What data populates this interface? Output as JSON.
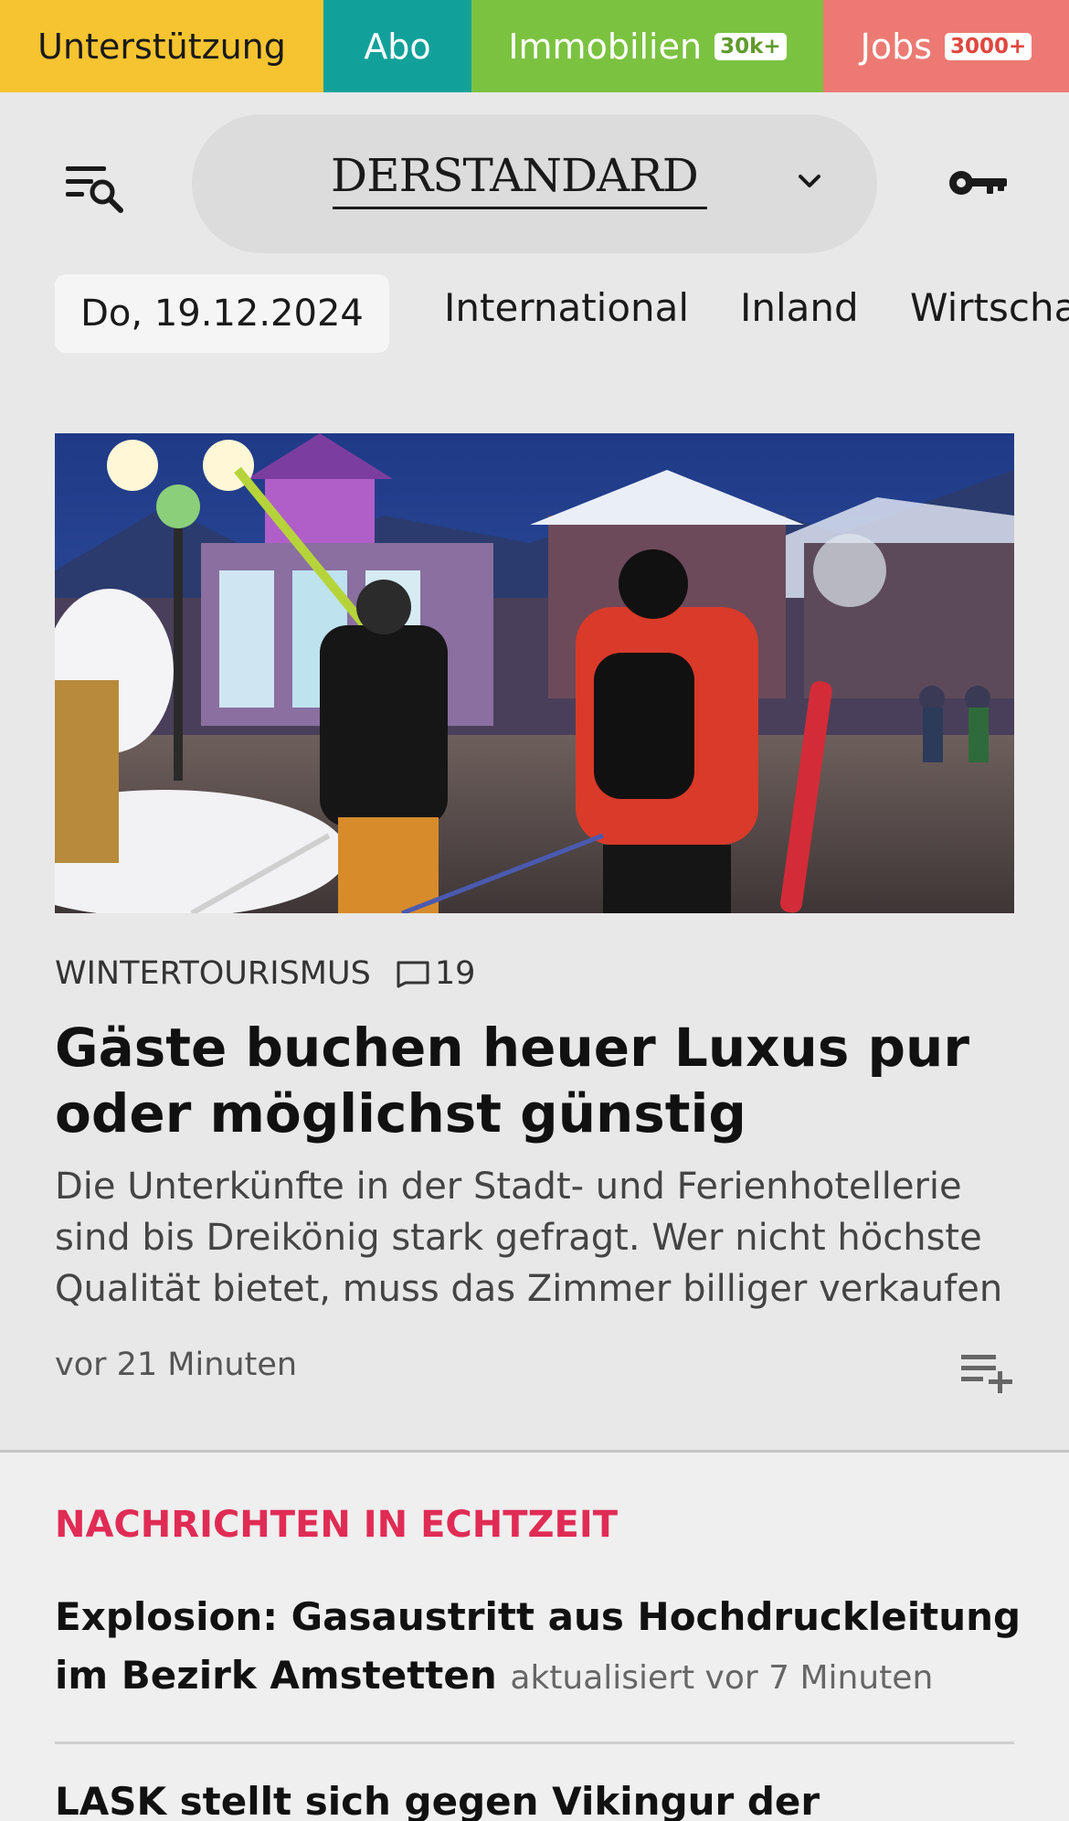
{
  "topnav": {
    "support": "Unterstützung",
    "abo": "Abo",
    "immobilien": "Immobilien",
    "immobilien_badge": "30k+",
    "jobs": "Jobs",
    "jobs_badge": "3000+"
  },
  "header": {
    "logo": "DERSTANDARD"
  },
  "sections": {
    "date": "Do, 19.12.2024",
    "tabs": [
      "International",
      "Inland",
      "Wirtschaft"
    ]
  },
  "hero": {
    "image_alt": "Skifahrer in einem beleuchteten Wintersportort am Abend",
    "kicker": "WINTERTOURISMUS",
    "comments": "19",
    "headline": "Gäste buchen heuer Luxus pur oder möglichst günstig",
    "teaser": "Die Unterkünfte in der Stadt- und Ferienhotellerie sind bis Dreikönig stark gefragt. Wer nicht höchste Qualität bietet, muss das Zimmer billiger verkaufen",
    "time": "vor 21 Minuten"
  },
  "live": {
    "title": "NACHRICHTEN IN ECHTZEIT",
    "items": [
      {
        "headline": "Explosion: Gasaustritt aus Hochdruckleitung im Bezirk Amstetten",
        "meta": "aktualisiert vor 7 Minuten"
      },
      {
        "headline": "LASK stellt sich gegen Vikingur der Charakter-"
      }
    ]
  },
  "colors": {
    "support": "#f6c431",
    "abo": "#12a19a",
    "immobilien": "#7cc241",
    "jobs": "#ec7a73",
    "live_accent": "#e02c55"
  }
}
